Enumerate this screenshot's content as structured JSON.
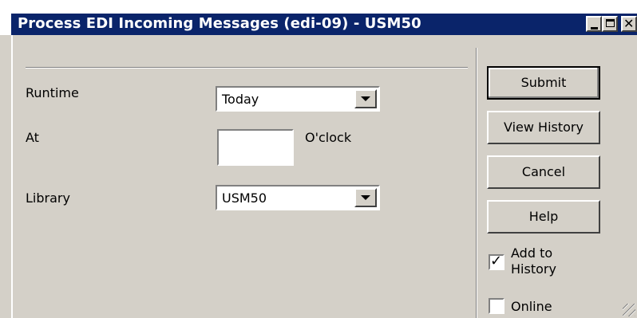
{
  "window": {
    "title": "Process EDI Incoming Messages (edi-09) - USM50",
    "controls": {
      "minimize": "minimize-icon",
      "maximize": "maximize-icon",
      "close": "close-icon"
    }
  },
  "form": {
    "runtime": {
      "label": "Runtime",
      "value": "Today"
    },
    "at": {
      "label": "At",
      "value": "",
      "suffix": "O'clock"
    },
    "library": {
      "label": "Library",
      "value": "USM50"
    }
  },
  "actions": {
    "submit": "Submit",
    "view_history": "View History",
    "cancel": "Cancel",
    "help": "Help"
  },
  "options": {
    "add_to_history": {
      "label_line1": "Add to",
      "label_line2": "History",
      "checked": true
    },
    "online": {
      "label": "Online",
      "checked": false
    }
  },
  "colors": {
    "titlebar": "#0a246a",
    "face": "#d4d0c8"
  }
}
